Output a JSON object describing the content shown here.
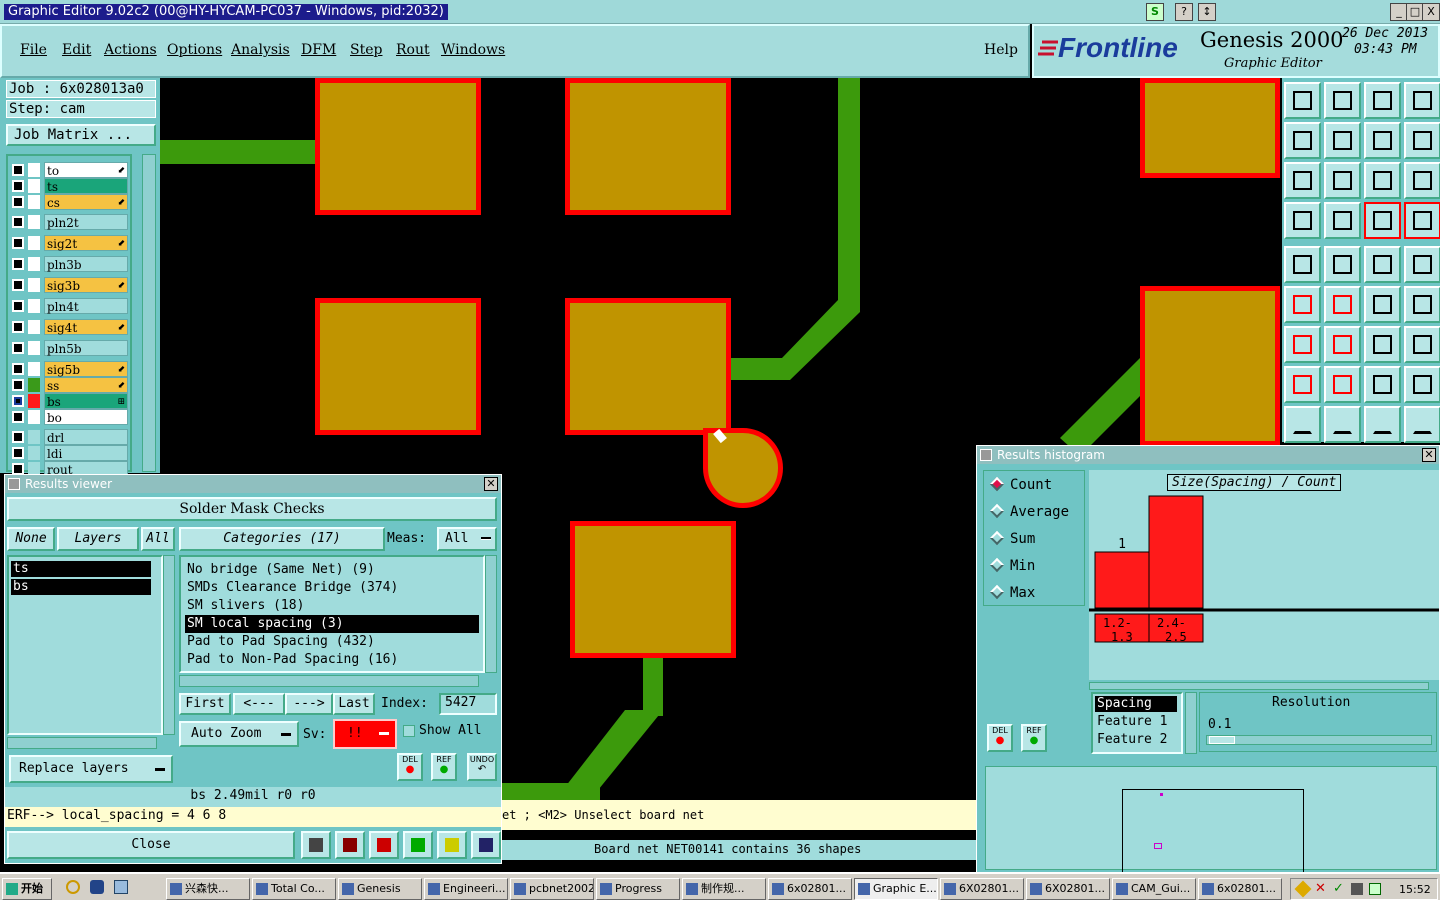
{
  "window": {
    "title": "Graphic Editor 9.02c2 (00@HY-HYCAM-PC037 - Windows, pid:2032)",
    "controls": [
      "S",
      "?",
      "↕",
      "_",
      "□",
      "X"
    ]
  },
  "menu": {
    "items": [
      "File",
      "Edit",
      "Actions",
      "Options",
      "Analysis",
      "DFM",
      "Step",
      "Rout",
      "Windows"
    ],
    "help": "Help"
  },
  "brand": {
    "logo": "Frontline",
    "product": "Genesis 2000",
    "subtitle": "Graphic Editor",
    "date": "26 Dec 2013",
    "time": "03:43 PM"
  },
  "left_panel": {
    "job": "Job : 6x028013a0",
    "step": "Step: cam",
    "job_matrix": "Job Matrix ...",
    "layers": [
      {
        "name": "to",
        "color": "#ffffff",
        "swatch": "#ffffff",
        "mark": "⬋"
      },
      {
        "name": "ts",
        "color": "#1aa57a",
        "swatch": "#ffffff",
        "mark": ""
      },
      {
        "name": "cs",
        "color": "#f5c242",
        "swatch": "#ffffff",
        "mark": "⬋"
      },
      {
        "name": "pln2t",
        "color": "#a0dcdc",
        "swatch": "#ffffff",
        "mark": ""
      },
      {
        "name": "sig2t",
        "color": "#f5c242",
        "swatch": "#ffffff",
        "mark": "⬋"
      },
      {
        "name": "pln3b",
        "color": "#a0dcdc",
        "swatch": "#ffffff",
        "mark": ""
      },
      {
        "name": "sig3b",
        "color": "#f5c242",
        "swatch": "#ffffff",
        "mark": "⬋"
      },
      {
        "name": "pln4t",
        "color": "#a0dcdc",
        "swatch": "#ffffff",
        "mark": ""
      },
      {
        "name": "sig4t",
        "color": "#f5c242",
        "swatch": "#ffffff",
        "mark": "⬋"
      },
      {
        "name": "pln5b",
        "color": "#a0dcdc",
        "swatch": "#ffffff",
        "mark": ""
      },
      {
        "name": "sig5b",
        "color": "#f5c242",
        "swatch": "#ffffff",
        "mark": "⬋"
      },
      {
        "name": "ss",
        "color": "#f5c242",
        "swatch": "#3a9a1a",
        "mark": "⬋"
      },
      {
        "name": "bs",
        "color": "#1aa57a",
        "swatch": "#ff1a1a",
        "mark": "⊞"
      },
      {
        "name": "bo",
        "color": "#ffffff",
        "swatch": "#ffffff",
        "mark": ""
      },
      {
        "name": "drl",
        "color": "#a0dcdc",
        "swatch": "#a0dcdc",
        "mark": ""
      },
      {
        "name": "ldi",
        "color": "#a0dcdc",
        "swatch": "#a0dcdc",
        "mark": ""
      },
      {
        "name": "rout",
        "color": "#a0dcdc",
        "swatch": "#a0dcdc",
        "mark": ""
      }
    ]
  },
  "results_viewer": {
    "title": "Results viewer",
    "header": "Solder Mask Checks",
    "none_btn": "None",
    "layers_btn": "Layers",
    "all_btn": "All",
    "layer_list": [
      "ts",
      "bs"
    ],
    "categories_label": "Categories (17)",
    "meas_label": "Meas:",
    "meas_value": "All",
    "categories": [
      "No bridge (Same Net) (9)",
      "SMDs Clearance Bridge (374)",
      "SM slivers (18)",
      "SM local spacing (3)",
      "Pad to Pad Spacing (432)",
      "Pad to Non-Pad Spacing (16)"
    ],
    "selected_category": 3,
    "first": "First",
    "prev": "<---",
    "next": "--->",
    "last": "Last",
    "index_label": "Index:",
    "index_value": "5427",
    "auto_zoom": "Auto Zoom",
    "sv_label": "Sv:",
    "sv_value": "!!",
    "show_all": "Show All",
    "replace_layers": "Replace layers",
    "del": "DEL",
    "ref": "REF",
    "undo": "UNDO",
    "measure_line": "bs 2.49mil   r0   r0",
    "erf_line": "ERF--> local_spacing = 4 6 8",
    "close": "Close"
  },
  "histogram": {
    "title": "Results histogram",
    "modes": [
      "Count",
      "Average",
      "Sum",
      "Min",
      "Max"
    ],
    "selected_mode": 0,
    "chart_title": "Size(Spacing) / Count",
    "del": "DEL",
    "ref": "REF",
    "params": [
      "Spacing",
      "Feature 1",
      "Feature 2"
    ],
    "resolution_label": "Resolution",
    "resolution_value": "0.1",
    "chart_data": {
      "type": "bar",
      "categories": [
        "1.2-1.3",
        "2.4-2.5"
      ],
      "values": [
        1,
        2
      ],
      "ylim": [
        0,
        2
      ],
      "bar_color": "#ff1a1a",
      "title": "Size(Spacing) / Count"
    }
  },
  "status": {
    "mouse_hint": "et ; <M2> Unselect board net",
    "net_info": "Board net NET00141 contains 36 shapes"
  },
  "taskbar": {
    "start": "开始",
    "tasks": [
      "兴森快...",
      "Total Co...",
      "Genesis",
      "Engineeri...",
      "pcbnet2002",
      "Progress",
      "制作规...",
      "6x02801...",
      "Graphic E...",
      "6X02801...",
      "6X02801...",
      "CAM_Gui...",
      "6x02801..."
    ],
    "clock": "15:52"
  },
  "colors": {
    "panel": "#6fc5c5",
    "pad_fill": "#c09400",
    "pad_outline": "#ff0000",
    "trace": "#3c9a0c"
  }
}
